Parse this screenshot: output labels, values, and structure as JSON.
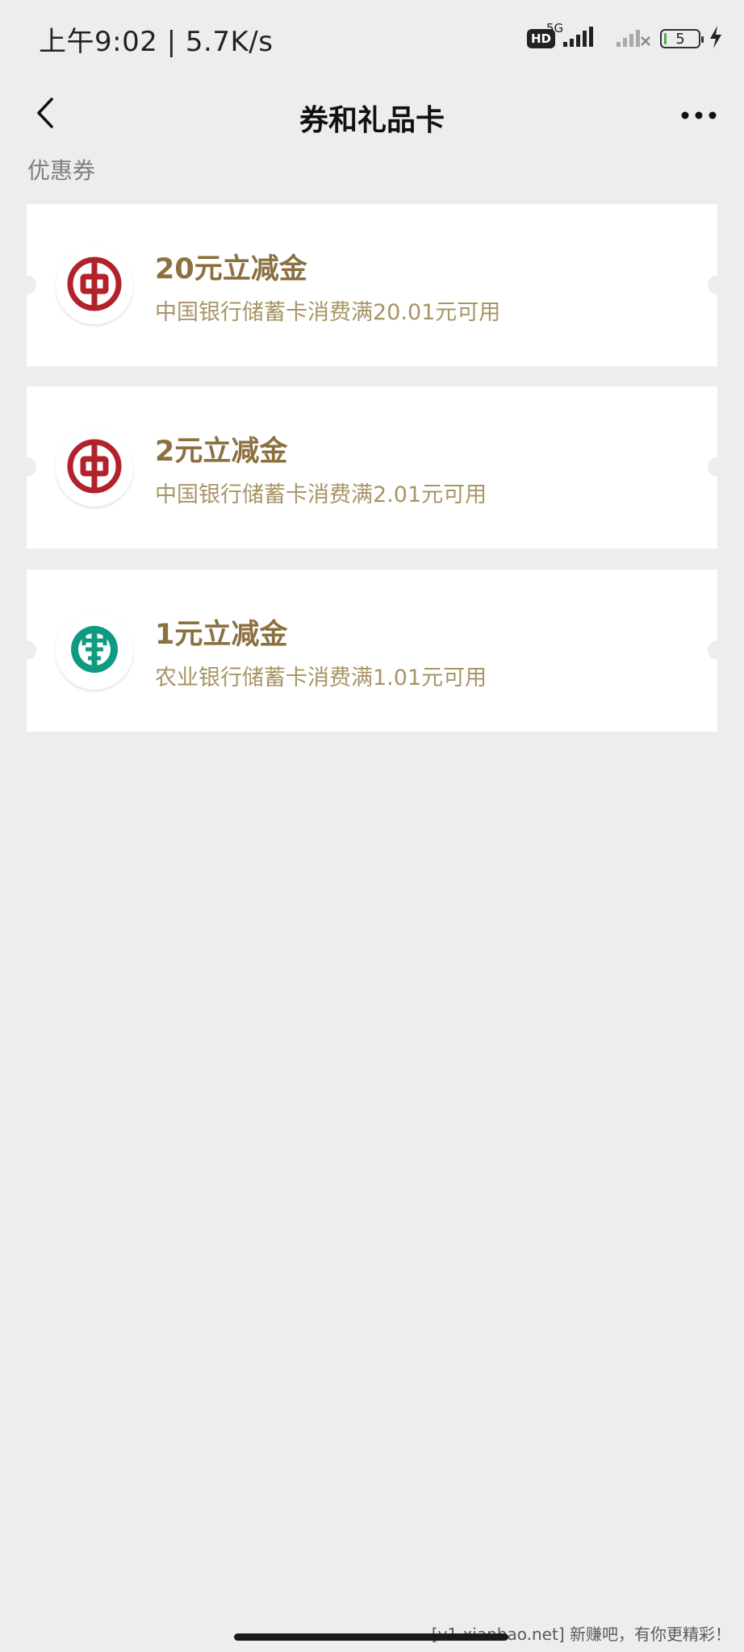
{
  "status_bar": {
    "time": "上午9:02 | 5.7K/s",
    "hd_label": "HD",
    "network_label": "5G",
    "battery_level": "5"
  },
  "nav": {
    "title": "券和礼品卡",
    "back_icon": "chevron-left-icon",
    "more_icon": "more-dots-icon"
  },
  "section": {
    "label": "优惠券"
  },
  "coupons": [
    {
      "title": "20元立减金",
      "description": "中国银行储蓄卡消费满20.01元可用",
      "bank_logo": "boc-logo",
      "logo_color": "#b1222a"
    },
    {
      "title": "2元立减金",
      "description": "中国银行储蓄卡消费满2.01元可用",
      "bank_logo": "boc-logo",
      "logo_color": "#b1222a"
    },
    {
      "title": "1元立减金",
      "description": "农业银行储蓄卡消费满1.01元可用",
      "bank_logo": "abc-logo",
      "logo_color": "#0f9b82"
    }
  ],
  "watermark": "[v1.xianbao.net] 新赚吧，有你更精彩！",
  "colors": {
    "background": "#ededed",
    "card": "#ffffff",
    "coupon_title": "#8c7140",
    "coupon_desc": "#a89466"
  }
}
